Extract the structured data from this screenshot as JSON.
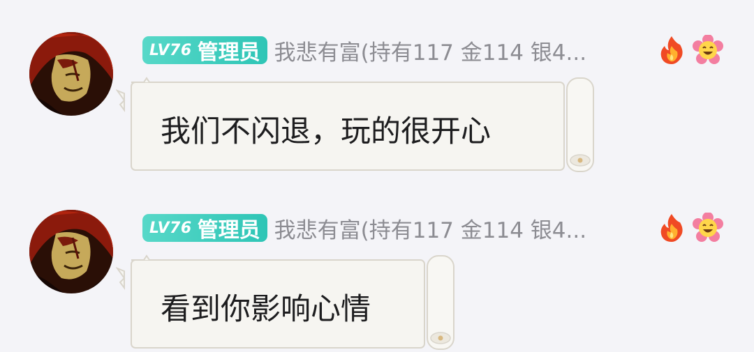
{
  "messages": [
    {
      "avatar_icon": "shanks-portrait-avatar-icon",
      "level_badge": "LV76",
      "role_badge": "管理员",
      "username": "我悲有富(持有117 金114 银4...",
      "status_icons": [
        "fire-icon",
        "grinning-flower-icon"
      ],
      "text": "我们不闪退，玩的很开心"
    },
    {
      "avatar_icon": "shanks-portrait-avatar-icon",
      "level_badge": "LV76",
      "role_badge": "管理员",
      "username": "我悲有富(持有117 金114 银4...",
      "status_icons": [
        "fire-icon",
        "grinning-flower-icon"
      ],
      "text": "看到你影响心情"
    }
  ],
  "colors": {
    "background": "#f4f4f8",
    "badge": "#2ec5b6",
    "username": "#8c8c92",
    "bubble_fill": "#f6f5f1",
    "bubble_border": "#d9d5cb"
  }
}
